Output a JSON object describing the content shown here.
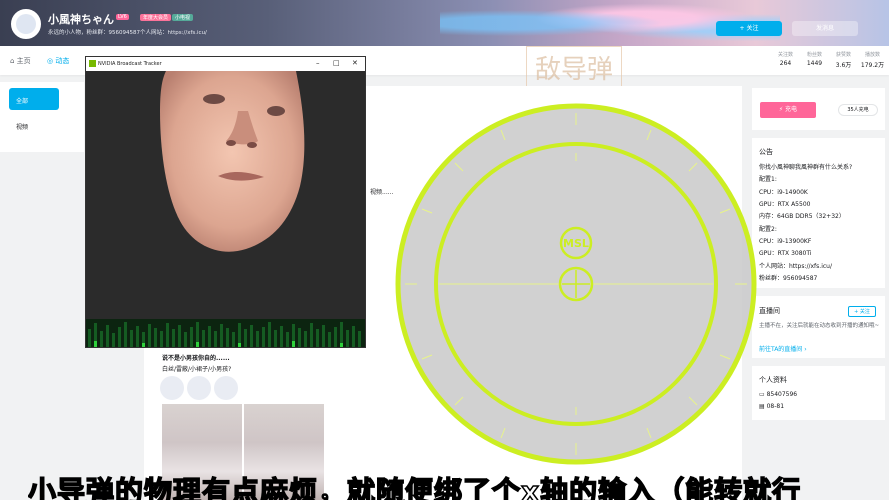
{
  "profile": {
    "username": "小風神ちゃん",
    "level": "LV6",
    "tag_1": "年度大会员",
    "tag_2": "小电视",
    "signature": "永远的小人物，粉丝群：956094587个人网站：https://xfs.icu/",
    "follow_label": "+ 关注",
    "message_label": "发消息"
  },
  "nav": {
    "home": "主页",
    "dynamic": "动态"
  },
  "stats": [
    {
      "label": "关注数",
      "value": "264"
    },
    {
      "label": "粉丝数",
      "value": "1449"
    },
    {
      "label": "获赞数",
      "value": "3.6万"
    },
    {
      "label": "播放数",
      "value": "179.2万"
    }
  ],
  "sidemenu": {
    "all": "全部",
    "video": "视频"
  },
  "watermark": "敌导弹",
  "nvidia": {
    "title": "NVIDIA Broadcast Tracker",
    "minimize": "–",
    "maximize": "□",
    "close": "✕"
  },
  "feed": {
    "inline_video": "视频......",
    "post_line_1": "说不是小男孩你自的......",
    "post_line_2": "白丝/雷蔽/小裙子/小男孩?"
  },
  "right": {
    "charge_label": "充电",
    "charge_count": "35人充电",
    "notice_title": "公告",
    "notice_lines": [
      "你找小風神聊我風神群有什么关系?",
      "配置1:",
      "CPU：i9-14900K",
      "GPU：RTX A5500",
      "内存：64GB DDR5（32+32）",
      "配置2:",
      "CPU：i9-13900KF",
      "GPU：RTX 3080Ti",
      "个人网站：https://xfs.icu/",
      "粉丝群：956094587"
    ],
    "live_title": "直播间",
    "live_follow": "+ 关注",
    "live_desc": "主播不在，关注后就能在动态收到开播的通知哦~",
    "live_link": "前往TA的直播间 ›",
    "info_title": "个人资料",
    "uid": "85407596",
    "birthday": "08-81"
  },
  "hud": {
    "label": "MSL",
    "color": "#ccee22"
  },
  "subtitle": "小导弹的物理有点麻烦，就随便绑了个x轴的输入（能转就行"
}
